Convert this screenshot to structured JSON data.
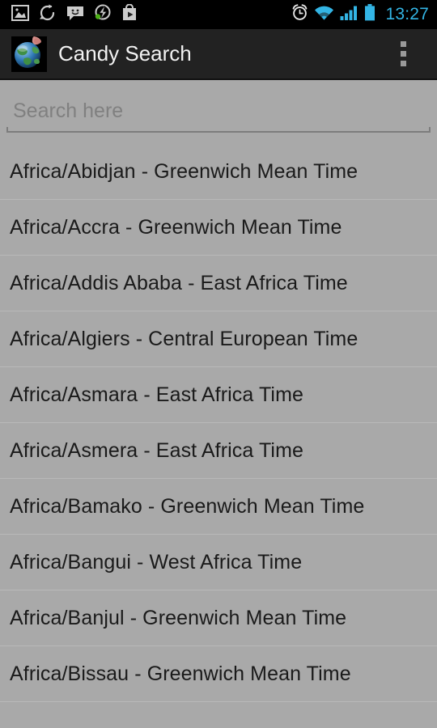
{
  "status_bar": {
    "time": "13:27",
    "notification_icons": [
      {
        "name": "image-icon",
        "label": "Image"
      },
      {
        "name": "sync-icon",
        "label": "Sync"
      },
      {
        "name": "chat-smiley-icon",
        "label": "Messaging"
      },
      {
        "name": "glympse-icon",
        "label": "Glympse"
      },
      {
        "name": "play-store-icon",
        "label": "Play Store"
      }
    ],
    "system_icons": [
      {
        "name": "alarm-clock-icon",
        "label": "Alarm"
      },
      {
        "name": "wifi-icon",
        "label": "Wi-Fi"
      },
      {
        "name": "cell-signal-icon",
        "label": "Signal"
      },
      {
        "name": "battery-icon",
        "label": "Battery"
      }
    ],
    "colors": {
      "background": "#000000",
      "accent": "#33b5e5",
      "icon": "#cccccc"
    }
  },
  "action_bar": {
    "title": "Candy Search",
    "app_icon": "globe-touch-icon",
    "overflow_menu": "overflow-menu-icon",
    "colors": {
      "background": "#222222",
      "title": "#f2f2f2"
    }
  },
  "search": {
    "placeholder": "Search here",
    "value": ""
  },
  "list": {
    "items": [
      {
        "label": "Africa/Abidjan - Greenwich Mean Time"
      },
      {
        "label": "Africa/Accra - Greenwich Mean Time"
      },
      {
        "label": "Africa/Addis Ababa - East Africa Time"
      },
      {
        "label": "Africa/Algiers - Central European Time"
      },
      {
        "label": "Africa/Asmara - East Africa Time"
      },
      {
        "label": "Africa/Asmera - East Africa Time"
      },
      {
        "label": "Africa/Bamako - Greenwich Mean Time"
      },
      {
        "label": "Africa/Bangui - West Africa Time"
      },
      {
        "label": "Africa/Banjul - Greenwich Mean Time"
      },
      {
        "label": "Africa/Bissau - Greenwich Mean Time"
      }
    ]
  },
  "colors": {
    "page_background": "#a9a9a9",
    "divider": "#b9b9b9",
    "list_text": "#1a1a1a"
  }
}
